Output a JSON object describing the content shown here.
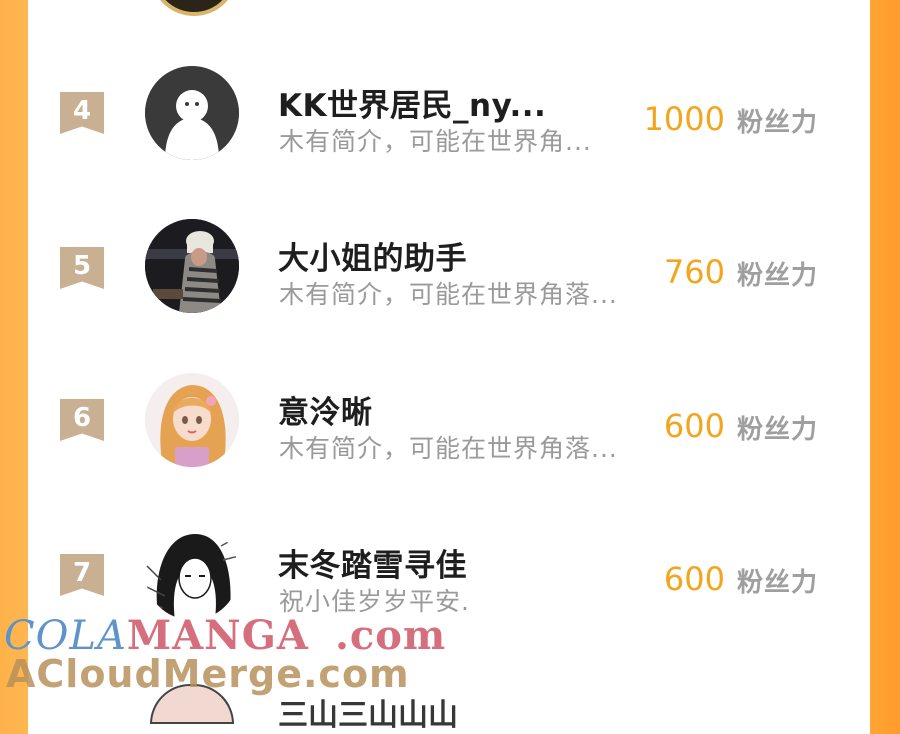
{
  "rows": [
    {
      "rank": "4",
      "name": "KK世界居民_ny...",
      "bio": "木有简介，可能在世界角...",
      "score": "1000",
      "unit": "粉丝力",
      "avatar": "placeholder-ghost-avatar"
    },
    {
      "rank": "5",
      "name": "大小姐的助手",
      "bio": "木有简介，可能在世界角落...",
      "score": "760",
      "unit": "粉丝力",
      "avatar": "photo-avatar-girl-hat"
    },
    {
      "rank": "6",
      "name": "意泠晰",
      "bio": "木有简介，可能在世界角落...",
      "score": "600",
      "unit": "粉丝力",
      "avatar": "anime-avatar-girl-blonde"
    },
    {
      "rank": "7",
      "name": "末冬踏雪寻佳",
      "bio": "祝小佳岁岁平安.",
      "score": "600",
      "unit": "粉丝力",
      "avatar": "manga-avatar-girl-black-hair"
    }
  ],
  "next_row_partial": {
    "name": "三山三山山山"
  },
  "watermark": {
    "line1_a": "COLA",
    "line1_b": "MANGA",
    ".com": ".com",
    "line2": "ACloudMerge.com"
  },
  "colors": {
    "score": "#f3a51d",
    "rank_badge": "#c9b092",
    "frame": "#ffa534"
  }
}
